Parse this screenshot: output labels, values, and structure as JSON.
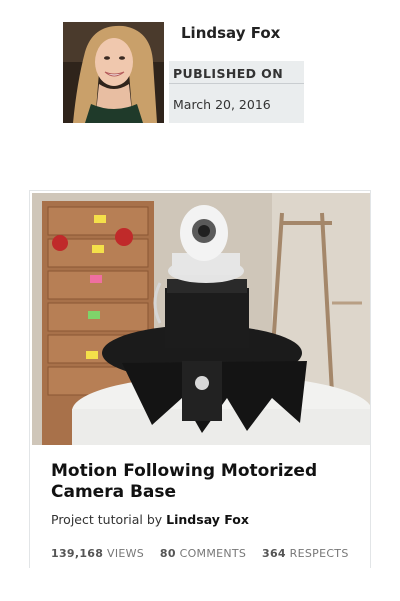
{
  "author": {
    "name": "Lindsay Fox",
    "published_label": "PUBLISHED ON",
    "published_date": "March 20, 2016"
  },
  "project": {
    "title": "Motion Following Motorized Camera Base",
    "byline_prefix": "Project tutorial by",
    "byline_author": "Lindsay Fox",
    "stats": {
      "views_count": "139,168",
      "views_label": "VIEWS",
      "comments_count": "80",
      "comments_label": "COMMENTS",
      "respects_count": "364",
      "respects_label": "RESPECTS"
    }
  }
}
